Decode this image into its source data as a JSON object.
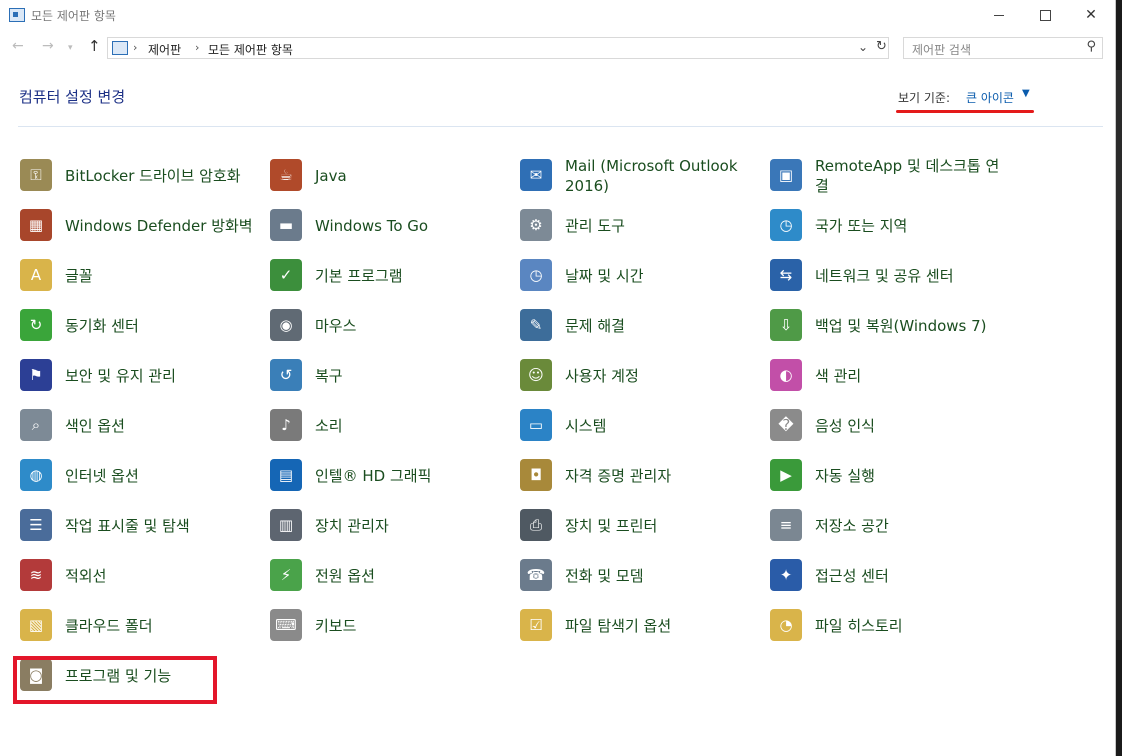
{
  "window": {
    "title": "모든 제어판 항목"
  },
  "address": {
    "crumbs": [
      "제어판",
      "모든 제어판 항목"
    ]
  },
  "search": {
    "placeholder": "제어판 검색"
  },
  "header": {
    "title": "컴퓨터 설정 변경",
    "view_by_label": "보기 기준:",
    "view_by_value": "큰 아이콘"
  },
  "colors": {
    "accent": "#1e3287",
    "link": "#0b5cad",
    "highlight": "#e3162a"
  },
  "items": [
    {
      "label": "BitLocker 드라이브 암호화",
      "icon": "bitlocker-key-icon"
    },
    {
      "label": "Java",
      "icon": "java-icon"
    },
    {
      "label": "Mail (Microsoft Outlook 2016)",
      "icon": "mail-icon"
    },
    {
      "label": "RemoteApp 및 데스크톱 연결",
      "icon": "remoteapp-icon"
    },
    {
      "label": "Windows Defender 방화벽",
      "icon": "firewall-icon"
    },
    {
      "label": "Windows To Go",
      "icon": "usb-drive-icon"
    },
    {
      "label": "관리 도구",
      "icon": "admin-tools-icon"
    },
    {
      "label": "국가 또는 지역",
      "icon": "globe-clock-icon"
    },
    {
      "label": "글꼴",
      "icon": "font-folder-icon"
    },
    {
      "label": "기본 프로그램",
      "icon": "default-programs-icon"
    },
    {
      "label": "날짜 및 시간",
      "icon": "calendar-clock-icon"
    },
    {
      "label": "네트워크 및 공유 센터",
      "icon": "network-icon"
    },
    {
      "label": "동기화 센터",
      "icon": "sync-icon"
    },
    {
      "label": "마우스",
      "icon": "mouse-icon"
    },
    {
      "label": "문제 해결",
      "icon": "troubleshoot-icon"
    },
    {
      "label": "백업 및 복원(Windows 7)",
      "icon": "backup-icon"
    },
    {
      "label": "보안 및 유지 관리",
      "icon": "flag-icon"
    },
    {
      "label": "복구",
      "icon": "recovery-icon"
    },
    {
      "label": "사용자 계정",
      "icon": "users-icon"
    },
    {
      "label": "색 관리",
      "icon": "color-management-icon"
    },
    {
      "label": "색인 옵션",
      "icon": "indexing-icon"
    },
    {
      "label": "소리",
      "icon": "speaker-icon"
    },
    {
      "label": "시스템",
      "icon": "system-icon"
    },
    {
      "label": "음성 인식",
      "icon": "microphone-icon"
    },
    {
      "label": "인터넷 옵션",
      "icon": "internet-options-icon"
    },
    {
      "label": "인텔® HD 그래픽",
      "icon": "intel-graphics-icon"
    },
    {
      "label": "자격 증명 관리자",
      "icon": "credential-vault-icon"
    },
    {
      "label": "자동 실행",
      "icon": "autoplay-icon"
    },
    {
      "label": "작업 표시줄 및 탐색",
      "icon": "taskbar-icon"
    },
    {
      "label": "장치 관리자",
      "icon": "device-manager-icon"
    },
    {
      "label": "장치 및 프린터",
      "icon": "printer-icon"
    },
    {
      "label": "저장소 공간",
      "icon": "storage-spaces-icon"
    },
    {
      "label": "적외선",
      "icon": "infrared-icon"
    },
    {
      "label": "전원 옵션",
      "icon": "power-options-icon"
    },
    {
      "label": "전화 및 모뎀",
      "icon": "phone-modem-icon"
    },
    {
      "label": "접근성 센터",
      "icon": "ease-of-access-icon"
    },
    {
      "label": "클라우드 폴더",
      "icon": "work-folders-icon"
    },
    {
      "label": "키보드",
      "icon": "keyboard-icon"
    },
    {
      "label": "파일 탐색기 옵션",
      "icon": "file-explorer-options-icon"
    },
    {
      "label": "파일 히스토리",
      "icon": "file-history-icon"
    },
    {
      "label": "프로그램 및 기능",
      "icon": "programs-features-icon"
    }
  ]
}
